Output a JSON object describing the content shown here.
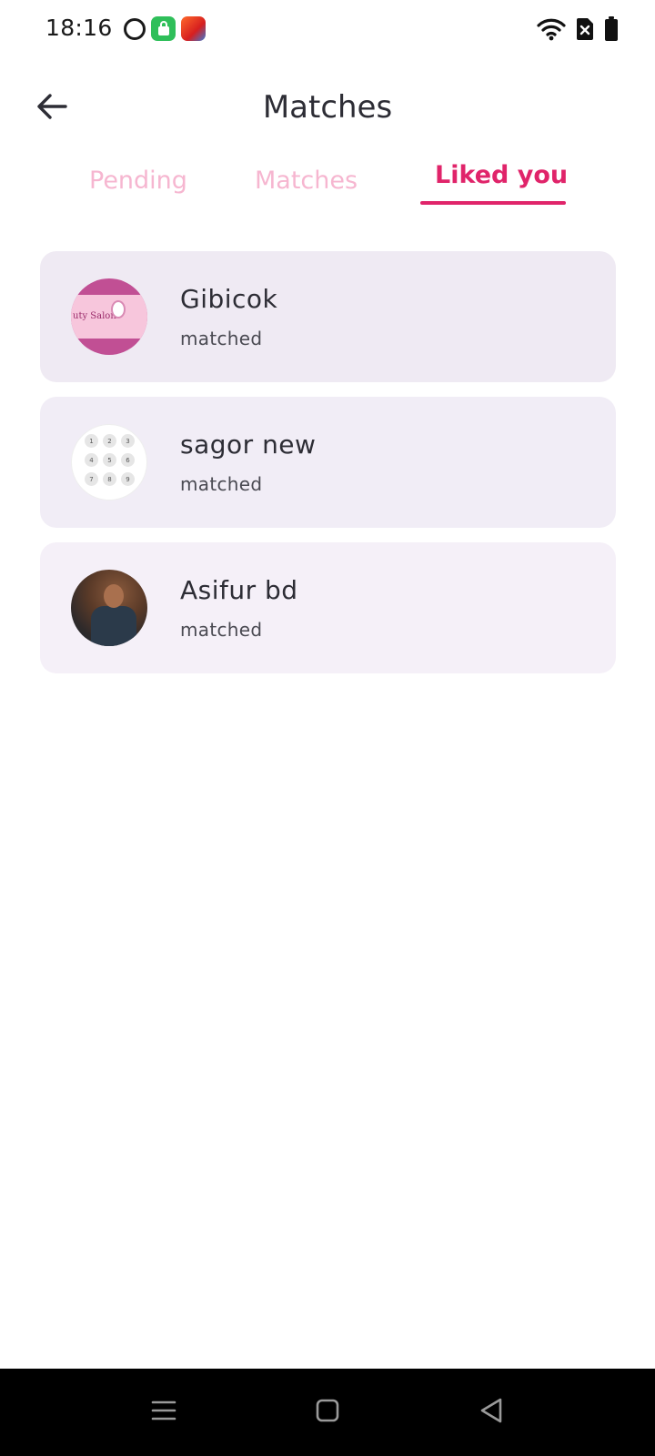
{
  "status_bar": {
    "time": "18:16",
    "notification_icons": [
      "face-app-icon",
      "shopping-bag-icon",
      "game-icon"
    ],
    "system_icons": [
      "wifi-icon",
      "sim-off-icon",
      "battery-icon"
    ]
  },
  "header": {
    "title": "Matches",
    "back_icon": "arrow-left-icon"
  },
  "tabs": [
    {
      "label": "Pending",
      "active": false
    },
    {
      "label": "Matches",
      "active": false
    },
    {
      "label": "Liked you",
      "active": true
    }
  ],
  "colors": {
    "accent": "#e0246a",
    "tab_inactive": "#f6b6d0",
    "card_background": "#efeaf3",
    "nav_background": "#000000"
  },
  "matches": [
    {
      "name": "Gibicok",
      "status": "matched",
      "avatar_text": "uty Salon"
    },
    {
      "name": "sagor new",
      "status": "matched"
    },
    {
      "name": "Asifur bd",
      "status": "matched"
    }
  ],
  "keypad_digits": [
    "1",
    "2",
    "3",
    "4",
    "5",
    "6",
    "7",
    "8",
    "9"
  ],
  "nav_bar": {
    "icons": [
      "menu-icon",
      "home-icon",
      "back-triangle-icon"
    ]
  }
}
